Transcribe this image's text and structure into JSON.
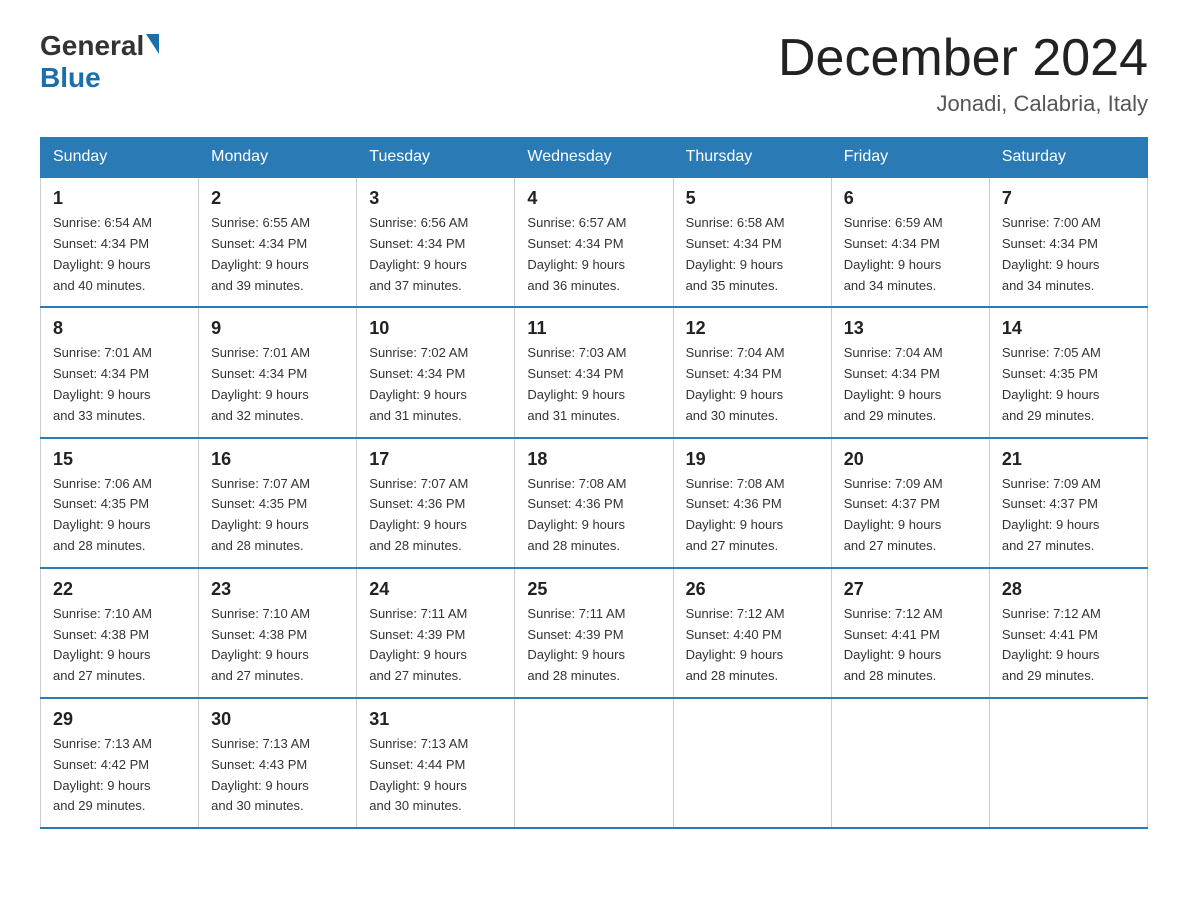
{
  "header": {
    "logo_general": "General",
    "logo_blue": "Blue",
    "month_title": "December 2024",
    "location": "Jonadi, Calabria, Italy"
  },
  "weekdays": [
    "Sunday",
    "Monday",
    "Tuesday",
    "Wednesday",
    "Thursday",
    "Friday",
    "Saturday"
  ],
  "weeks": [
    [
      {
        "day": "1",
        "sunrise": "6:54 AM",
        "sunset": "4:34 PM",
        "daylight": "9 hours and 40 minutes."
      },
      {
        "day": "2",
        "sunrise": "6:55 AM",
        "sunset": "4:34 PM",
        "daylight": "9 hours and 39 minutes."
      },
      {
        "day": "3",
        "sunrise": "6:56 AM",
        "sunset": "4:34 PM",
        "daylight": "9 hours and 37 minutes."
      },
      {
        "day": "4",
        "sunrise": "6:57 AM",
        "sunset": "4:34 PM",
        "daylight": "9 hours and 36 minutes."
      },
      {
        "day": "5",
        "sunrise": "6:58 AM",
        "sunset": "4:34 PM",
        "daylight": "9 hours and 35 minutes."
      },
      {
        "day": "6",
        "sunrise": "6:59 AM",
        "sunset": "4:34 PM",
        "daylight": "9 hours and 34 minutes."
      },
      {
        "day": "7",
        "sunrise": "7:00 AM",
        "sunset": "4:34 PM",
        "daylight": "9 hours and 34 minutes."
      }
    ],
    [
      {
        "day": "8",
        "sunrise": "7:01 AM",
        "sunset": "4:34 PM",
        "daylight": "9 hours and 33 minutes."
      },
      {
        "day": "9",
        "sunrise": "7:01 AM",
        "sunset": "4:34 PM",
        "daylight": "9 hours and 32 minutes."
      },
      {
        "day": "10",
        "sunrise": "7:02 AM",
        "sunset": "4:34 PM",
        "daylight": "9 hours and 31 minutes."
      },
      {
        "day": "11",
        "sunrise": "7:03 AM",
        "sunset": "4:34 PM",
        "daylight": "9 hours and 31 minutes."
      },
      {
        "day": "12",
        "sunrise": "7:04 AM",
        "sunset": "4:34 PM",
        "daylight": "9 hours and 30 minutes."
      },
      {
        "day": "13",
        "sunrise": "7:04 AM",
        "sunset": "4:34 PM",
        "daylight": "9 hours and 29 minutes."
      },
      {
        "day": "14",
        "sunrise": "7:05 AM",
        "sunset": "4:35 PM",
        "daylight": "9 hours and 29 minutes."
      }
    ],
    [
      {
        "day": "15",
        "sunrise": "7:06 AM",
        "sunset": "4:35 PM",
        "daylight": "9 hours and 28 minutes."
      },
      {
        "day": "16",
        "sunrise": "7:07 AM",
        "sunset": "4:35 PM",
        "daylight": "9 hours and 28 minutes."
      },
      {
        "day": "17",
        "sunrise": "7:07 AM",
        "sunset": "4:36 PM",
        "daylight": "9 hours and 28 minutes."
      },
      {
        "day": "18",
        "sunrise": "7:08 AM",
        "sunset": "4:36 PM",
        "daylight": "9 hours and 28 minutes."
      },
      {
        "day": "19",
        "sunrise": "7:08 AM",
        "sunset": "4:36 PM",
        "daylight": "9 hours and 27 minutes."
      },
      {
        "day": "20",
        "sunrise": "7:09 AM",
        "sunset": "4:37 PM",
        "daylight": "9 hours and 27 minutes."
      },
      {
        "day": "21",
        "sunrise": "7:09 AM",
        "sunset": "4:37 PM",
        "daylight": "9 hours and 27 minutes."
      }
    ],
    [
      {
        "day": "22",
        "sunrise": "7:10 AM",
        "sunset": "4:38 PM",
        "daylight": "9 hours and 27 minutes."
      },
      {
        "day": "23",
        "sunrise": "7:10 AM",
        "sunset": "4:38 PM",
        "daylight": "9 hours and 27 minutes."
      },
      {
        "day": "24",
        "sunrise": "7:11 AM",
        "sunset": "4:39 PM",
        "daylight": "9 hours and 27 minutes."
      },
      {
        "day": "25",
        "sunrise": "7:11 AM",
        "sunset": "4:39 PM",
        "daylight": "9 hours and 28 minutes."
      },
      {
        "day": "26",
        "sunrise": "7:12 AM",
        "sunset": "4:40 PM",
        "daylight": "9 hours and 28 minutes."
      },
      {
        "day": "27",
        "sunrise": "7:12 AM",
        "sunset": "4:41 PM",
        "daylight": "9 hours and 28 minutes."
      },
      {
        "day": "28",
        "sunrise": "7:12 AM",
        "sunset": "4:41 PM",
        "daylight": "9 hours and 29 minutes."
      }
    ],
    [
      {
        "day": "29",
        "sunrise": "7:13 AM",
        "sunset": "4:42 PM",
        "daylight": "9 hours and 29 minutes."
      },
      {
        "day": "30",
        "sunrise": "7:13 AM",
        "sunset": "4:43 PM",
        "daylight": "9 hours and 30 minutes."
      },
      {
        "day": "31",
        "sunrise": "7:13 AM",
        "sunset": "4:44 PM",
        "daylight": "9 hours and 30 minutes."
      },
      null,
      null,
      null,
      null
    ]
  ],
  "labels": {
    "sunrise": "Sunrise:",
    "sunset": "Sunset:",
    "daylight": "Daylight:"
  }
}
